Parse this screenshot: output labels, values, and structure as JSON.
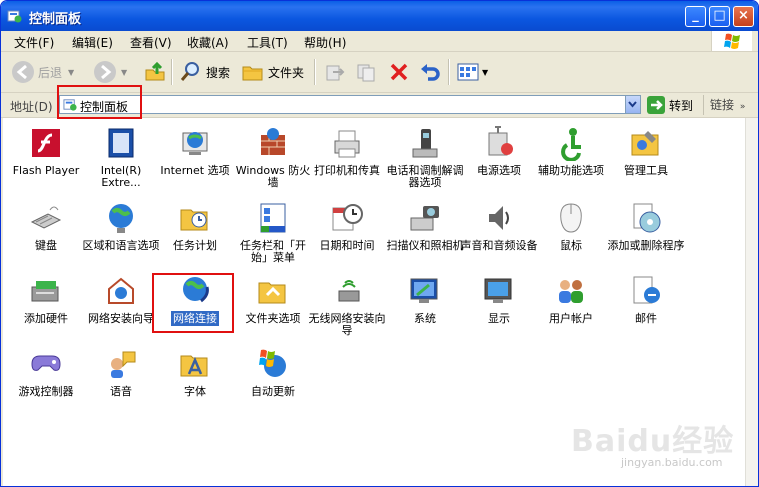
{
  "window": {
    "title": "控制面板"
  },
  "titlebar_buttons": {
    "minimize": "_",
    "maximize": "□",
    "close": "×"
  },
  "menu": [
    {
      "label": "文件(F)"
    },
    {
      "label": "编辑(E)"
    },
    {
      "label": "查看(V)"
    },
    {
      "label": "收藏(A)"
    },
    {
      "label": "工具(T)"
    },
    {
      "label": "帮助(H)"
    }
  ],
  "toolbar": {
    "back_label": "后退",
    "search_label": "搜索",
    "folders_label": "文件夹"
  },
  "address": {
    "label": "地址(D)",
    "value": "控制面板",
    "go_label": "转到",
    "links_label": "链接"
  },
  "items": [
    {
      "label": "Flash Player",
      "icon": "flash-icon"
    },
    {
      "label": "Intel(R) Extre...",
      "icon": "intel-graphics-icon"
    },
    {
      "label": "Internet 选项",
      "icon": "internet-options-icon"
    },
    {
      "label": "Windows 防火墙",
      "icon": "firewall-icon"
    },
    {
      "label": "打印机和传真",
      "icon": "printer-icon"
    },
    {
      "label": "电话和调制解调器选项",
      "icon": "phone-modem-icon"
    },
    {
      "label": "电源选项",
      "icon": "power-icon"
    },
    {
      "label": "辅助功能选项",
      "icon": "accessibility-icon"
    },
    {
      "label": "管理工具",
      "icon": "admin-tools-icon"
    },
    {
      "label": "键盘",
      "icon": "keyboard-icon"
    },
    {
      "label": "区域和语言选项",
      "icon": "region-globe-icon"
    },
    {
      "label": "任务计划",
      "icon": "scheduled-tasks-icon"
    },
    {
      "label": "任务栏和「开始」菜单",
      "icon": "taskbar-icon"
    },
    {
      "label": "日期和时间",
      "icon": "clock-icon"
    },
    {
      "label": "扫描仪和照相机",
      "icon": "scanner-camera-icon"
    },
    {
      "label": "声音和音频设备",
      "icon": "speaker-icon"
    },
    {
      "label": "鼠标",
      "icon": "mouse-icon"
    },
    {
      "label": "添加或删除程序",
      "icon": "add-remove-programs-icon"
    },
    {
      "label": "添加硬件",
      "icon": "add-hardware-icon"
    },
    {
      "label": "网络安装向导",
      "icon": "network-setup-icon"
    },
    {
      "label": "网络连接",
      "icon": "network-connections-icon",
      "selected": true
    },
    {
      "label": "文件夹选项",
      "icon": "folder-options-icon"
    },
    {
      "label": "无线网络安装向导",
      "icon": "wireless-setup-icon"
    },
    {
      "label": "系统",
      "icon": "system-icon"
    },
    {
      "label": "显示",
      "icon": "display-icon"
    },
    {
      "label": "用户帐户",
      "icon": "user-accounts-icon"
    },
    {
      "label": "邮件",
      "icon": "mail-icon"
    },
    {
      "label": "游戏控制器",
      "icon": "game-controller-icon"
    },
    {
      "label": "语音",
      "icon": "speech-icon"
    },
    {
      "label": "字体",
      "icon": "fonts-icon"
    },
    {
      "label": "自动更新",
      "icon": "auto-update-icon"
    }
  ],
  "watermark": {
    "brand": "Baidu经验",
    "url": "jingyan.baidu.com"
  },
  "colors": {
    "titlebar": "#0a5fe6",
    "selection": "#316ac5",
    "highlight_box": "#e01010"
  }
}
